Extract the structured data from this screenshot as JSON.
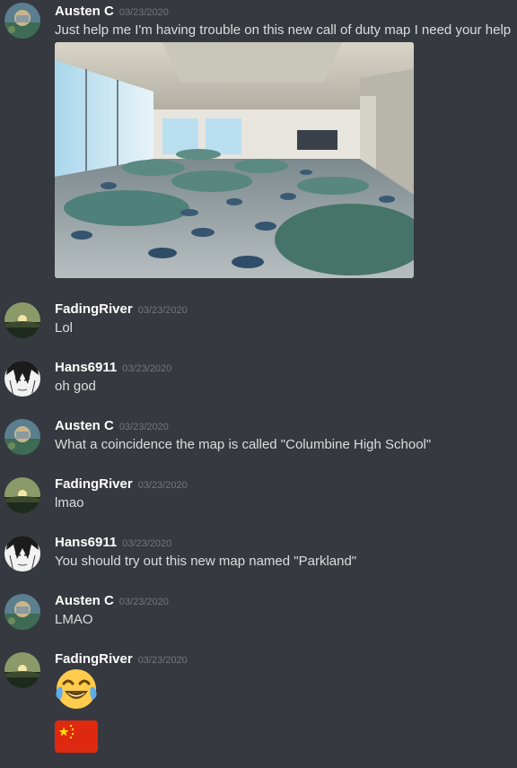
{
  "messages": [
    {
      "author": "Austen C",
      "timestamp": "03/23/2020",
      "text": "Just help me I'm having trouble on this new call of duty map I need your help",
      "attachment": "cafeteria-photo"
    },
    {
      "author": "FadingRiver",
      "timestamp": "03/23/2020",
      "text": "Lol"
    },
    {
      "author": "Hans6911",
      "timestamp": "03/23/2020",
      "text": "oh god"
    },
    {
      "author": "Austen C",
      "timestamp": "03/23/2020",
      "text": "What a coincidence the map is called \"Columbine High School\""
    },
    {
      "author": "FadingRiver",
      "timestamp": "03/23/2020",
      "text": "lmao"
    },
    {
      "author": "Hans6911",
      "timestamp": "03/23/2020",
      "text": "You should try out this new map named \"Parkland\""
    },
    {
      "author": "Austen C",
      "timestamp": "03/23/2020",
      "text": "LMAO"
    },
    {
      "author": "FadingRiver",
      "timestamp": "03/23/2020",
      "emojis": [
        "face-with-tears-of-joy-emoji",
        "china-flag-emoji"
      ]
    }
  ],
  "colors": {
    "background": "#36393f",
    "username": "#ffffff",
    "timestamp": "#72767d",
    "message_text": "#dcddde"
  }
}
